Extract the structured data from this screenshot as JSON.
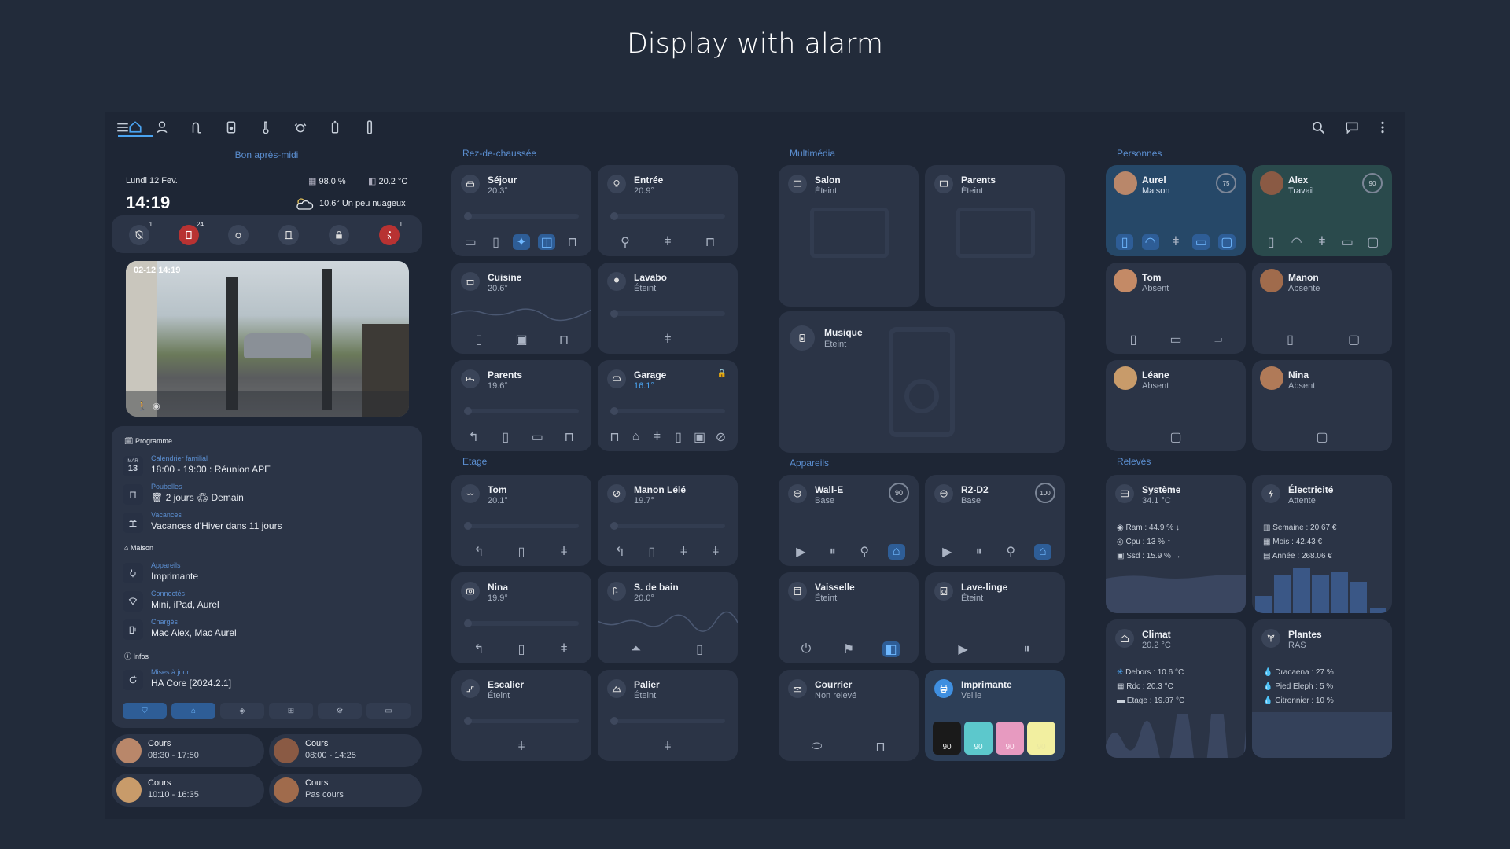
{
  "page_title": "Display with alarm",
  "greeting": "Bon après-midi",
  "date": "Lundi 12 Fev.",
  "time": "14:19",
  "humidity": "98.0 %",
  "indoor_temp": "20.2 °C",
  "weather": "10.6° Un peu nuageux",
  "status_badges": {
    "b1": "1",
    "b2": "24",
    "b3": "1"
  },
  "camera": {
    "timestamp": "02-12 14:19"
  },
  "program": {
    "header": "Programme",
    "cal_day": "MAR",
    "cal_num": "13",
    "rows": [
      {
        "label": "Calendrier familial",
        "value": "18:00 - 19:00 : Réunion APE"
      },
      {
        "label": "Poubelles",
        "value": "🗑 2 jours ♻ Demain"
      },
      {
        "label": "Vacances",
        "value": "Vacances d'Hiver dans 11 jours"
      }
    ],
    "house_header": "Maison",
    "house_rows": [
      {
        "label": "Appareils",
        "value": "Imprimante"
      },
      {
        "label": "Connectés",
        "value": "Mini, iPad, Aurel"
      },
      {
        "label": "Chargés",
        "value": "Mac Alex, Mac Aurel"
      }
    ],
    "info_header": "Infos",
    "info_rows": [
      {
        "label": "Mises à jour",
        "value": "HA Core [2024.2.1]"
      }
    ]
  },
  "courses": [
    {
      "title": "Cours",
      "value": "08:30 - 17:50"
    },
    {
      "title": "Cours",
      "value": "08:00 - 14:25"
    },
    {
      "title": "Cours",
      "value": "10:10 - 16:35"
    },
    {
      "title": "Cours",
      "value": "Pas cours"
    }
  ],
  "sections": {
    "rdc": "Rez-de-chaussée",
    "etage": "Etage",
    "multimedia": "Multimédia",
    "appareils": "Appareils",
    "personnes": "Personnes",
    "releves": "Relevés"
  },
  "rooms": {
    "sejour": {
      "name": "Séjour",
      "value": "20.3°"
    },
    "entree": {
      "name": "Entrée",
      "value": "20.9°"
    },
    "cuisine": {
      "name": "Cuisine",
      "value": "20.6°"
    },
    "lavabo": {
      "name": "Lavabo",
      "value": "Éteint"
    },
    "parents": {
      "name": "Parents",
      "value": "19.6°"
    },
    "garage": {
      "name": "Garage",
      "value": "16.1°"
    },
    "tom": {
      "name": "Tom",
      "value": "20.1°"
    },
    "manon": {
      "name": "Manon Lélé",
      "value": "19.7°"
    },
    "nina": {
      "name": "Nina",
      "value": "19.9°"
    },
    "sdb": {
      "name": "S. de bain",
      "value": "20.0°"
    },
    "escalier": {
      "name": "Escalier",
      "value": "Éteint"
    },
    "palier": {
      "name": "Palier",
      "value": "Éteint"
    }
  },
  "media": {
    "salon": {
      "name": "Salon",
      "value": "Éteint"
    },
    "parents": {
      "name": "Parents",
      "value": "Éteint"
    },
    "musique": {
      "name": "Musique",
      "value": "Eteint"
    }
  },
  "devices": {
    "walle": {
      "name": "Wall-E",
      "value": "Base",
      "battery": "90"
    },
    "r2d2": {
      "name": "R2-D2",
      "value": "Base",
      "battery": "100"
    },
    "vaisselle": {
      "name": "Vaisselle",
      "value": "Éteint"
    },
    "lavelinge": {
      "name": "Lave-linge",
      "value": "Éteint"
    },
    "courrier": {
      "name": "Courrier",
      "value": "Non relevé"
    },
    "imprimante": {
      "name": "Imprimante",
      "value": "Veille",
      "inks": [
        "90",
        "90",
        "90",
        "90"
      ]
    }
  },
  "persons": {
    "aurel": {
      "name": "Aurel",
      "value": "Maison",
      "battery": "75"
    },
    "alex": {
      "name": "Alex",
      "value": "Travail",
      "battery": "90"
    },
    "tom": {
      "name": "Tom",
      "value": "Absent"
    },
    "manon": {
      "name": "Manon",
      "value": "Absente"
    },
    "leane": {
      "name": "Léane",
      "value": "Absent"
    },
    "nina": {
      "name": "Nina",
      "value": "Absent"
    }
  },
  "readings": {
    "systeme": {
      "name": "Système",
      "value": "34.1 °C",
      "lines": [
        "Ram : 44.9 % ↓",
        "Cpu : 13 % ↑",
        "Ssd : 15.9 % →"
      ]
    },
    "electricite": {
      "name": "Électricité",
      "value": "Attente",
      "lines": [
        "Semaine : 20.67 €",
        "Mois : 42.43 €",
        "Année : 268.06 €"
      ]
    },
    "climat": {
      "name": "Climat",
      "value": "20.2 °C",
      "lines": [
        "Dehors : 10.6 °C",
        "Rdc : 20.3 °C",
        "Etage : 19.87 °C"
      ]
    },
    "plantes": {
      "name": "Plantes",
      "value": "RAS",
      "lines": [
        "Dracaena : 27 %",
        "Pied Eleph : 5 %",
        "Citronnier : 10 %"
      ]
    }
  },
  "colors": {
    "accent": "#4aa3f0",
    "alert": "#c0392b",
    "background": "#222b3a",
    "card": "#2b3446"
  }
}
